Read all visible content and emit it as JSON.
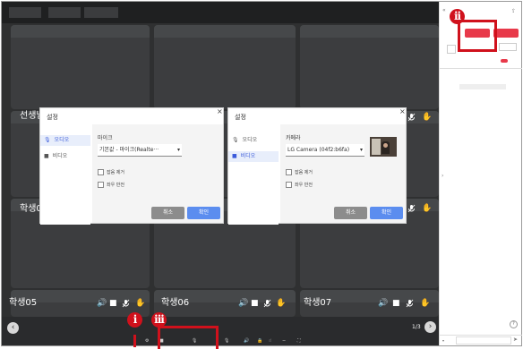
{
  "tabs": [
    "",
    "",
    ""
  ],
  "participants": {
    "teacher": "선생님",
    "s01": "학생0",
    "s05": "학생05",
    "s06": "학생06",
    "s07": "학생07"
  },
  "dialog_title": "설정",
  "nav_audio": "오디오",
  "nav_video": "비디오",
  "mic_label": "마이크",
  "mic_value": "기본값 - 마이크(Realte···",
  "camera_label": "카메라",
  "camera_value": "LG Camera (04f2:b6fa)",
  "check_1": "잡음 제거",
  "check_2": "좌우 반전",
  "cancel_label": "취소",
  "confirm_label": "확인",
  "page_indicator": "1/3",
  "toolbar_labels": [
    "",
    "",
    ""
  ],
  "right_panel": {
    "btn_1": "",
    "btn_2": "",
    "btn_3": "",
    "sub_1": "",
    "sub_2": "",
    "toggle_label": "",
    "chat_header": "",
    "chat_msg": "",
    "input_placeholder": ""
  },
  "markers": [
    "ii",
    "i",
    "iii"
  ],
  "colors": {
    "accent": "#e8394a",
    "marker": "#d0111c",
    "primary": "#5b8def",
    "stage": "#2f3031"
  }
}
